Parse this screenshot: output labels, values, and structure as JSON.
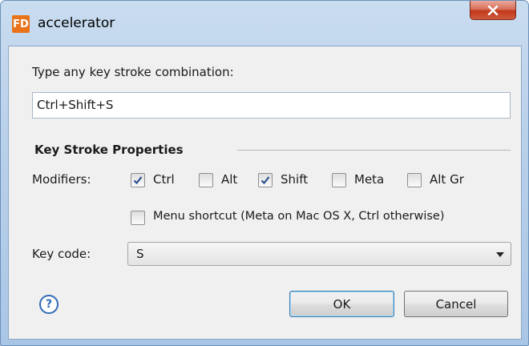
{
  "window": {
    "title": "accelerator",
    "app_icon": "fd-app-icon",
    "close_icon": "close-x-icon"
  },
  "prompt_label": "Type any key stroke combination:",
  "keystroke_value": "Ctrl+Shift+S",
  "section_title": "Key Stroke Properties",
  "modifiers_label": "Modifiers:",
  "modifiers": [
    {
      "label": "Ctrl",
      "checked": true
    },
    {
      "label": "Alt",
      "checked": false
    },
    {
      "label": "Shift",
      "checked": true
    },
    {
      "label": "Meta",
      "checked": false
    },
    {
      "label": "Alt Gr",
      "checked": false
    }
  ],
  "menu_shortcut": {
    "label": "Menu shortcut (Meta on Mac OS X, Ctrl otherwise)",
    "checked": false
  },
  "key_code_label": "Key code:",
  "key_code_value": "S",
  "help_icon": "question-icon",
  "buttons": {
    "ok": "OK",
    "cancel": "Cancel"
  },
  "colors": {
    "accent": "#2f6bb5",
    "close": "#c2381c",
    "app_icon": "#e8731b"
  }
}
